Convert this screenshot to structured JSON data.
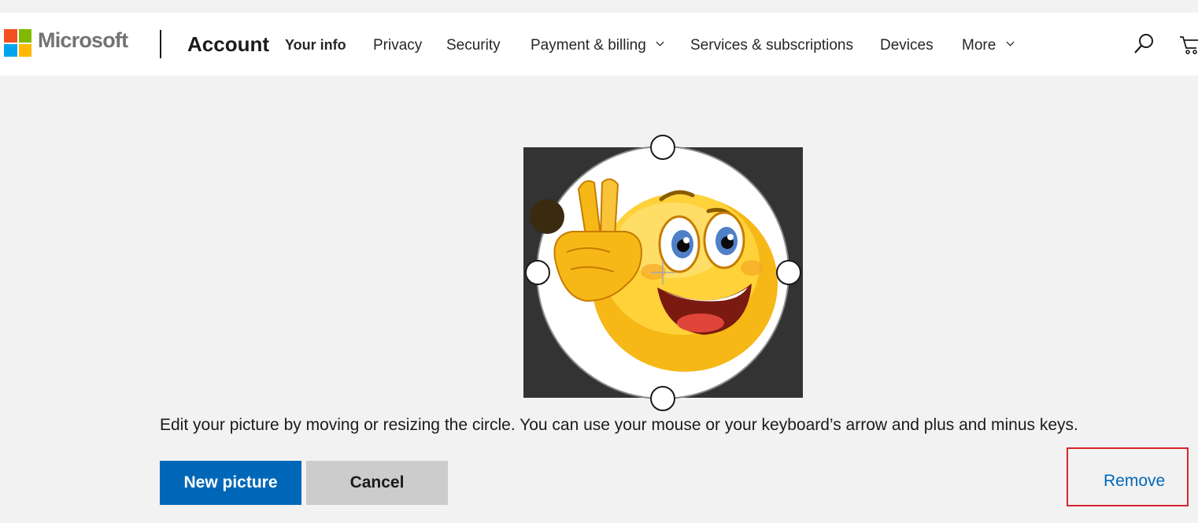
{
  "brand": {
    "name": "Microsoft",
    "logo_colors": [
      "#f25022",
      "#7fba00",
      "#00a4ef",
      "#ffb900"
    ]
  },
  "header": {
    "section_title": "Account",
    "nav": [
      {
        "label": "Your info",
        "active": true
      },
      {
        "label": "Privacy"
      },
      {
        "label": "Security"
      },
      {
        "label": "Payment & billing",
        "has_dropdown": true
      },
      {
        "label": "Services & subscriptions"
      },
      {
        "label": "Devices"
      },
      {
        "label": "More",
        "has_dropdown": true
      }
    ],
    "icons": [
      "search-icon",
      "cart-icon"
    ]
  },
  "editor": {
    "image_subject": "emoji-peace-sign",
    "background_color": "#333333"
  },
  "hint_text": "Edit your picture by moving or resizing the circle. You can use your mouse or your keyboard’s arrow and plus and minus keys.",
  "actions": {
    "new_picture": "New picture",
    "cancel": "Cancel",
    "remove": "Remove"
  },
  "colors": {
    "accent": "#0067b8",
    "highlight_border": "#d6262e"
  }
}
